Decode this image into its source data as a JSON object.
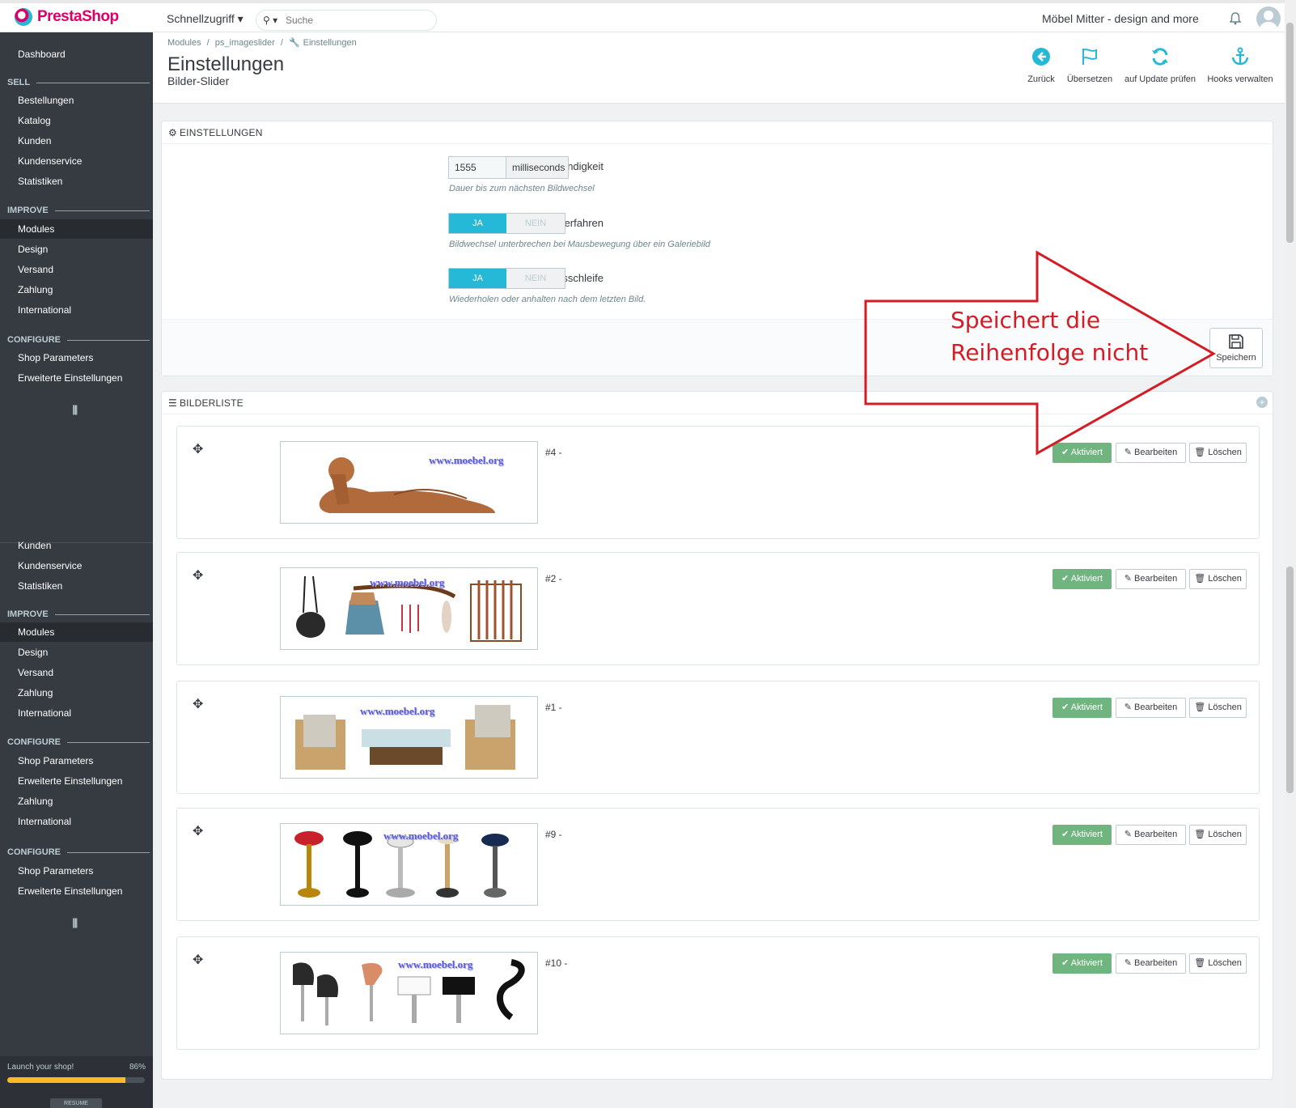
{
  "header": {
    "logo_text": "PrestaShop",
    "quick_access": "Schnellzugriff ▾",
    "search_placeholder": "Suche",
    "shop_name": "Möbel Mitter - design and more"
  },
  "sidebar": {
    "dashboard": "Dashboard",
    "sections": [
      {
        "head": "SELL",
        "items": [
          "Bestellungen",
          "Katalog",
          "Kunden",
          "Kundenservice",
          "Statistiken"
        ]
      },
      {
        "head": "IMPROVE",
        "items": [
          "Modules",
          "Design",
          "Versand",
          "Zahlung",
          "International"
        ]
      },
      {
        "head": "CONFIGURE",
        "items": [
          "Shop Parameters",
          "Erweiterte Einstellungen"
        ]
      }
    ],
    "dup_items_a": [
      "Kunden",
      "Kundenservice",
      "Statistiken"
    ],
    "dup_improve": {
      "head": "IMPROVE",
      "items": [
        "Modules",
        "Design",
        "Versand",
        "Zahlung",
        "International"
      ]
    },
    "dup_configure1": {
      "head": "CONFIGURE",
      "items": [
        "Shop Parameters",
        "Erweiterte Einstellungen",
        "Zahlung",
        "International"
      ]
    },
    "dup_configure2": {
      "head": "CONFIGURE",
      "items": [
        "Shop Parameters",
        "Erweiterte Einstellungen"
      ]
    },
    "launch_label": "Launch your shop!",
    "launch_percent": "86%",
    "launch_progress": 0.86,
    "resume_label": "RESUME"
  },
  "page": {
    "breadcrumb": [
      "Modules",
      "/",
      "ps_imageslider",
      "/",
      "Einstellungen"
    ],
    "title": "Einstellungen",
    "subtitle": "Bilder-Slider",
    "toolbar": [
      {
        "label": "Zurück",
        "icon": "back-circle-icon"
      },
      {
        "label": "Übersetzen",
        "icon": "flag-icon"
      },
      {
        "label": "auf Update prüfen",
        "icon": "refresh-icon"
      },
      {
        "label": "Hooks verwalten",
        "icon": "anchor-icon"
      }
    ]
  },
  "settings": {
    "panel_title": "EINSTELLUNGEN",
    "speed_label": "Geschwindigkeit",
    "speed_value": "1555",
    "speed_unit": "milliseconds",
    "speed_help": "Dauer bis zum nächsten Bildwechsel",
    "pause_label": "Pausieren beim Rüberfahren",
    "pause_help": "Bildwechsel unterbrechen bei Mausbewegung über ein Galeriebild",
    "loop_label": "Endlosschleife",
    "loop_help": "Wiederholen oder anhalten nach dem letzten Bild.",
    "yes": "JA",
    "no": "NEIN",
    "save_label": "Speichern"
  },
  "annotation": {
    "line1": "Speichert die",
    "line2": "Reihenfolge nicht",
    "color": "#d41c24"
  },
  "slides": {
    "panel_title": "BILDERLISTE",
    "watermark": "www.moebel.org",
    "active_label": "✔ Aktiviert",
    "edit_label": "Bearbeiten",
    "delete_label": "Löschen",
    "items": [
      {
        "id": "#4 -"
      },
      {
        "id": "#2 -"
      },
      {
        "id": "#1 -"
      },
      {
        "id": "#9 -"
      },
      {
        "id": "#10 -"
      }
    ]
  },
  "colors": {
    "accent": "#25b9d7",
    "brand": "#df0067",
    "success": "#70b580",
    "sidebar": "#363a41"
  }
}
